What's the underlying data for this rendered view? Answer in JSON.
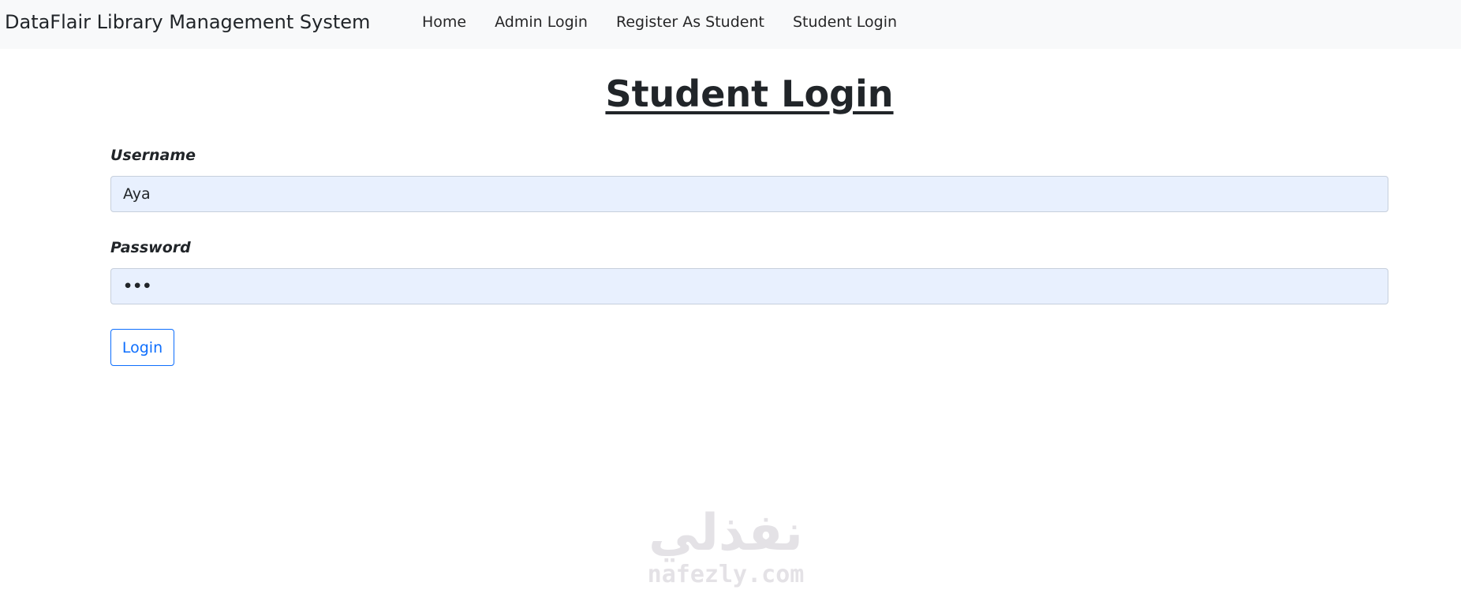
{
  "navbar": {
    "brand": "DataFlair Library Management System",
    "links": [
      {
        "label": "Home"
      },
      {
        "label": "Admin Login"
      },
      {
        "label": "Register As Student"
      },
      {
        "label": "Student Login"
      }
    ]
  },
  "page": {
    "title": "Student Login"
  },
  "form": {
    "username": {
      "label": "Username",
      "value": "Aya"
    },
    "password": {
      "label": "Password",
      "value": "•••"
    },
    "submit_label": "Login"
  },
  "watermark": {
    "arabic": "نفذلي",
    "latin": "nafezly.com"
  }
}
